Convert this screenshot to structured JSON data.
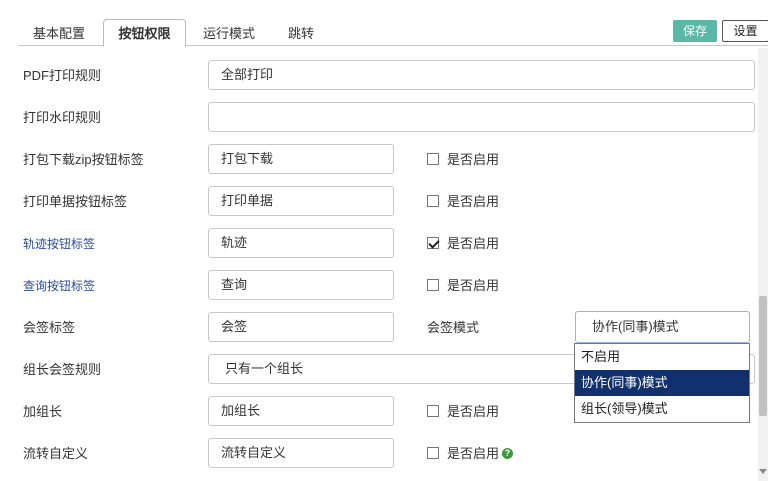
{
  "tabs": [
    {
      "label": "基本配置",
      "active": false
    },
    {
      "label": "按钮权限",
      "active": true
    },
    {
      "label": "运行模式",
      "active": false
    },
    {
      "label": "跳转",
      "active": false
    }
  ],
  "toolbar": {
    "save_label": "保存",
    "settings_label": "设置"
  },
  "rows": [
    {
      "label": "PDF打印规则",
      "value": "全部打印"
    },
    {
      "label": "打印水印规则",
      "value": ""
    },
    {
      "label": "打包下载zip按钮标签",
      "value": "打包下载",
      "enable_label": "是否启用",
      "checked": false
    },
    {
      "label": "打印单据按钮标签",
      "value": "打印单据",
      "enable_label": "是否启用",
      "checked": false
    },
    {
      "label": "轨迹按钮标签",
      "value": "轨迹",
      "enable_label": "是否启用",
      "checked": true
    },
    {
      "label": "查询按钮标签",
      "value": "查询",
      "enable_label": "是否启用",
      "checked": false
    },
    {
      "label": "会签标签",
      "value": "会签",
      "mode_label": "会签模式",
      "mode_value": "协作(同事)模式"
    },
    {
      "label": "组长会签规则",
      "value": "只有一个组长"
    },
    {
      "label": "加组长",
      "value": "加组长",
      "enable_label": "是否启用",
      "checked": false
    },
    {
      "label": "流转自定义",
      "value": "流转自定义",
      "enable_label": "是否启用",
      "checked": false
    }
  ],
  "dropdown": {
    "options": [
      "不启用",
      "协作(同事)模式",
      "组长(领导)模式"
    ],
    "selected_index": 1
  },
  "colors": {
    "save_button": "#5bb7a6",
    "selected_option": "#12306e",
    "help_icon": "#3a9a3a",
    "label_blue": "#2a4d9b"
  },
  "icons": {
    "help": "help-circle-icon",
    "check": "checkmark-icon"
  }
}
